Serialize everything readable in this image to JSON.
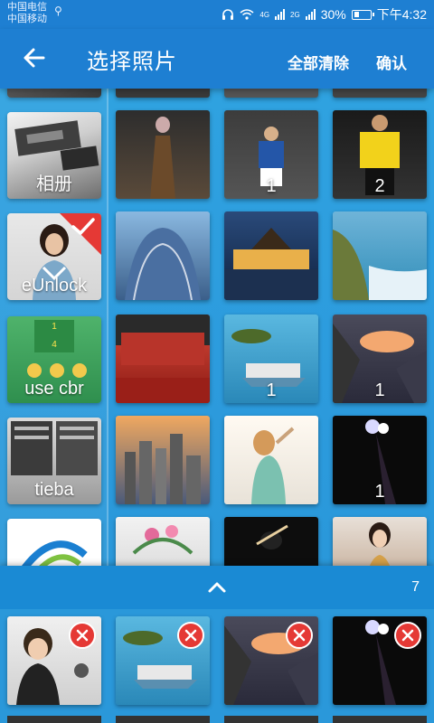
{
  "status_bar": {
    "carrier_1": "中国电信",
    "carrier_2": "中国移动",
    "net_1": "4G",
    "net_2": "2G",
    "battery": "30%",
    "time": "下午4:32"
  },
  "app_bar": {
    "title": "选择照片",
    "clear_all": "全部清除",
    "confirm": "确认"
  },
  "albums": [
    {
      "label": "相册"
    },
    {
      "label": "eUnlock",
      "selected": true
    },
    {
      "label": "use cbr"
    },
    {
      "label": "tieba"
    },
    {
      "label": ""
    }
  ],
  "photos": [
    {
      "count": ""
    },
    {
      "count": "1"
    },
    {
      "count": "2"
    },
    {
      "count": ""
    },
    {
      "count": ""
    },
    {
      "count": ""
    },
    {
      "count": ""
    },
    {
      "count": "1"
    },
    {
      "count": "1"
    },
    {
      "count": ""
    },
    {
      "count": ""
    },
    {
      "count": "1"
    },
    {
      "count": ""
    },
    {
      "count": ""
    },
    {
      "count": ""
    }
  ],
  "drawer": {
    "selected_count": "7"
  },
  "colors": {
    "primary": "#1e7fd2",
    "accent_red": "#e53935"
  },
  "icons": [
    "back-arrow-icon",
    "check-icon",
    "chevron-up-icon",
    "remove-icon"
  ]
}
